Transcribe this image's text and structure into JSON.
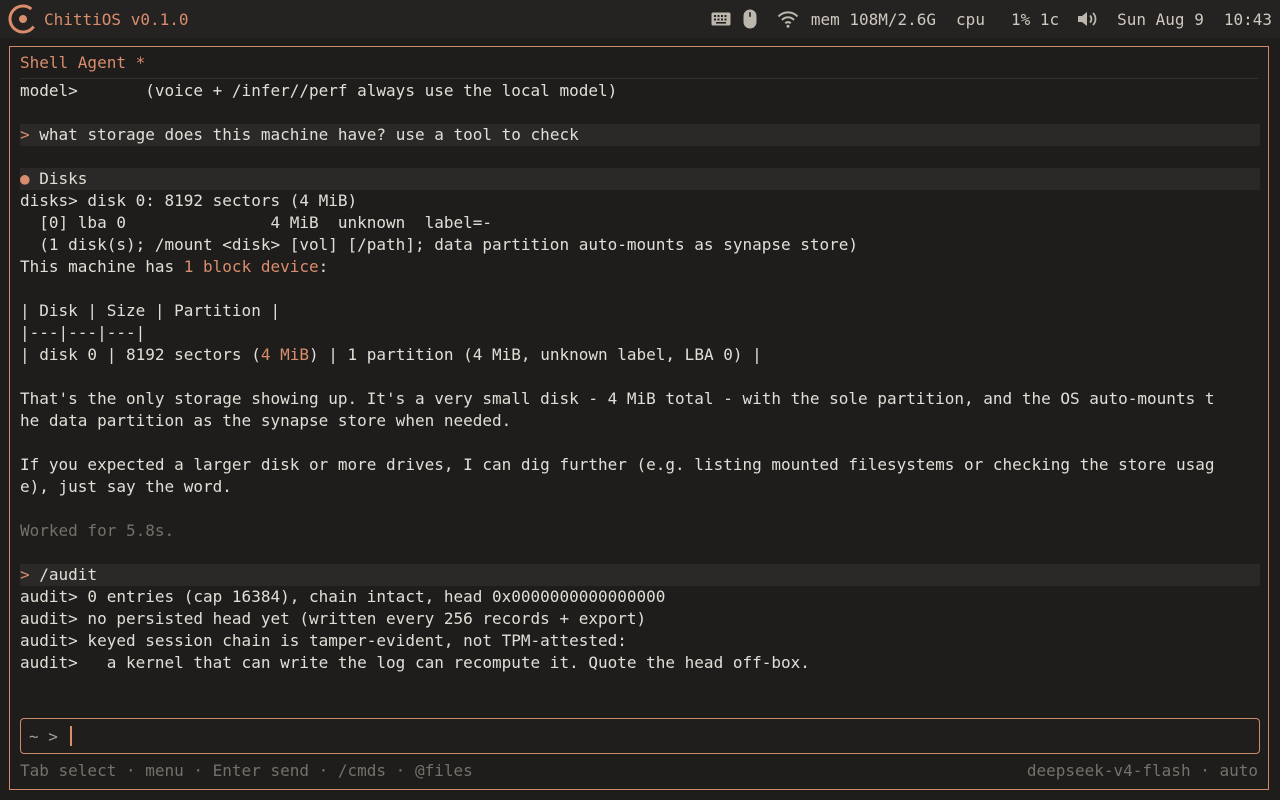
{
  "topbar": {
    "brand": "ChittiOS v0.1.0",
    "mem": "mem 108M/2.6G",
    "cpu_label": "cpu",
    "cpu_value": "1% 1c",
    "date": "Sun Aug 9",
    "time": "10:43",
    "icons": [
      "keyboard-icon",
      "mouse-icon",
      "wifi-icon",
      "volume-icon"
    ]
  },
  "window": {
    "title": "Shell Agent *"
  },
  "log": {
    "model_line": "model>       (voice + /infer//perf always use the local model)",
    "user1_prompt": ">",
    "user1_text": " what storage does this machine have? use a tool to check",
    "tool_dot": "●",
    "tool_name": " Disks",
    "disks1": "disks> disk 0: 8192 sectors (4 MiB)",
    "disks2": "  [0] lba 0               4 MiB  unknown  label=-",
    "disks3": "  (1 disk(s); /mount <disk> [vol] [/path]; data partition auto-mounts as synapse store)",
    "answer_pre": "This machine has ",
    "answer_hl": "1 block device",
    "answer_post": ":",
    "table_header": "| Disk | Size | Partition |",
    "table_sep": "|---|---|---|",
    "row_pre": "| disk 0 | 8192 sectors (",
    "row_hl": "4 MiB",
    "row_post": ") | 1 partition (4 MiB, unknown label, LBA 0) |",
    "para1_a": "That's the only storage showing up. It's a very small disk - 4 MiB total - with the sole partition, and the OS auto-mounts t",
    "para1_b": "he data partition as the synapse store when needed.",
    "para2_a": "If you expected a larger disk or more drives, I can dig further (e.g. listing mounted filesystems or checking the store usag",
    "para2_b": "e), just say the word.",
    "worked": "Worked for 5.8s.",
    "user2_prompt": ">",
    "user2_text": " /audit",
    "audit1": "audit> 0 entries (cap 16384), chain intact, head 0x0000000000000000",
    "audit2": "audit> no persisted head yet (written every 256 records + export)",
    "audit3": "audit> keyed session chain is tamper-evident, not TPM-attested:",
    "audit4": "audit>   a kernel that can write the log can recompute it. Quote the head off-box."
  },
  "input": {
    "prompt": "~ > ",
    "value": ""
  },
  "footer": {
    "hints": "Tab select · menu · Enter send · /cmds · @files",
    "model": "deepseek-v4-flash · auto"
  },
  "colors": {
    "accent": "#d98d6c",
    "background": "#1e1d1b",
    "text": "#e2ddd6",
    "dim": "#75706a"
  }
}
